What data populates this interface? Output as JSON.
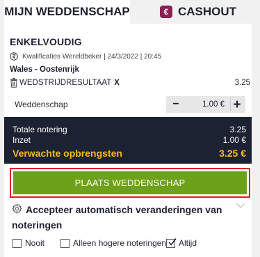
{
  "tabs": {
    "active": "MIJN WEDDENSCHAP",
    "cashout": "CASHOUT",
    "cashout_icon_glyph": "€"
  },
  "bet": {
    "type": "ENKELVOUDIG",
    "event_info": "Kwalificaties Wereldbeker | 24/3/2022 | 20:45",
    "match": "Wales - Oostenrijk",
    "market": "WEDSTRIJDRESULTAAT",
    "pick": "X",
    "odds": "3.25"
  },
  "stake": {
    "label": "Weddenschap",
    "value": "1.00 €",
    "minus": "−",
    "plus": "+"
  },
  "summary": {
    "total_odds_label": "Totale notering",
    "total_odds_value": "3.25",
    "stake_label": "Inzet",
    "stake_value": "1.00 €",
    "return_label": "Verwachte opbrengsten",
    "return_value": "3.25 €"
  },
  "place_bet": {
    "label": "PLAATS WEDDENSCHAP"
  },
  "odds_changes": {
    "text": "Accepteer automatisch veranderingen van noteringen",
    "options": [
      {
        "label": "Nooit",
        "checked": false
      },
      {
        "label": "Alleen hogere noteringen",
        "checked": false
      },
      {
        "label": "Altijd",
        "checked": true
      }
    ]
  },
  "colors": {
    "summary_bg": "#1c2232",
    "return_accent": "#f7b81c",
    "place_button": "#6ea11a",
    "highlight_border": "#e0192a",
    "cashout_badge": "#8c1f52"
  },
  "icons": [
    "euro-icon",
    "football-icon",
    "trash-icon",
    "minus-icon",
    "plus-icon",
    "gear-icon",
    "chevron-down-icon",
    "checkbox-icon"
  ]
}
